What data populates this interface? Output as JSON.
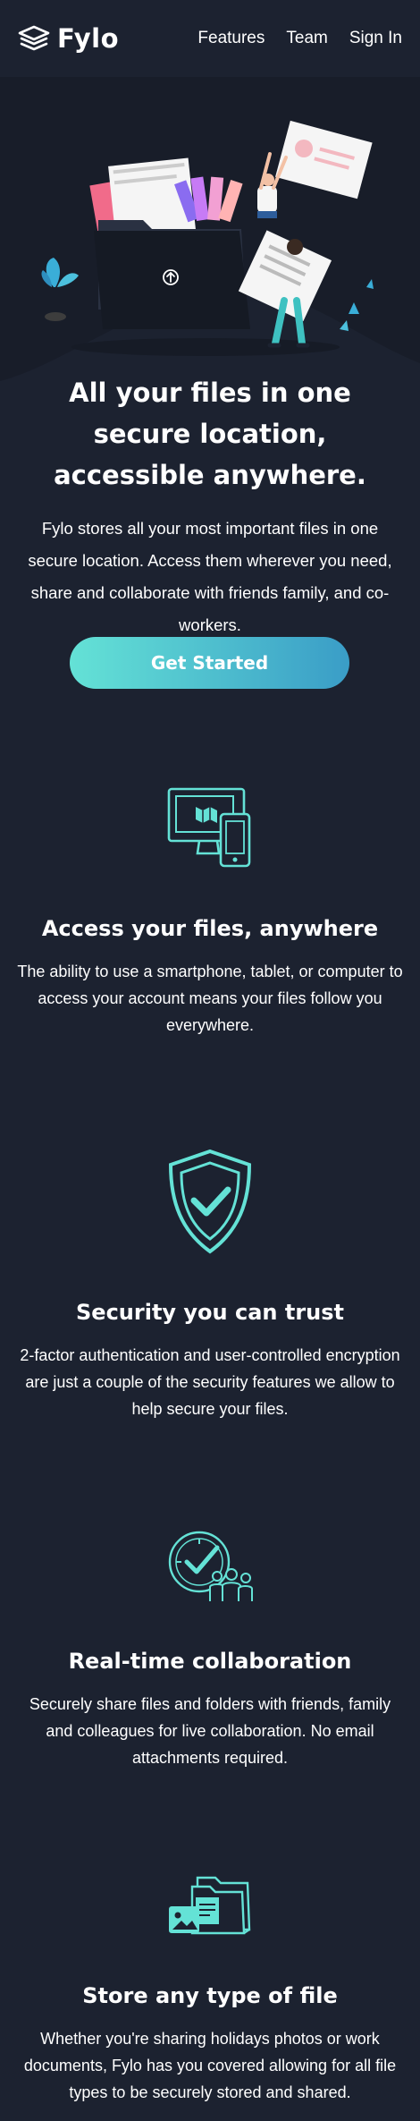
{
  "brand": {
    "name": "Fylo",
    "accent": "#64e2d6",
    "accent_dark": "#3a9dc7",
    "background": "#1c2230"
  },
  "nav": {
    "items": [
      "Features",
      "Team",
      "Sign In"
    ]
  },
  "hero": {
    "title": "All your files in one secure location, accessible anywhere.",
    "text": "Fylo stores all your most important files in one secure location. Access them wherever you need, share and collaborate with friends family, and co-workers.",
    "cta_label": "Get Started"
  },
  "features": [
    {
      "icon": "devices-icon",
      "title": "Access your files, anywhere",
      "text": "The ability to use a smartphone, tablet, or computer to access your account means your files follow you everywhere."
    },
    {
      "icon": "shield-check-icon",
      "title": "Security you can trust",
      "text": "2-factor authentication and user-controlled encryption are just a couple of the security features we allow to help secure your files."
    },
    {
      "icon": "collaboration-icon",
      "title": "Real-time collaboration",
      "text": "Securely share files and folders with friends, family and colleagues for live collaboration. No email attachments required."
    },
    {
      "icon": "folder-files-icon",
      "title": "Store any type of file",
      "text": "Whether you're sharing holidays photos or work documents, Fylo has you covered allowing for all file types to be securely stored and shared."
    }
  ]
}
